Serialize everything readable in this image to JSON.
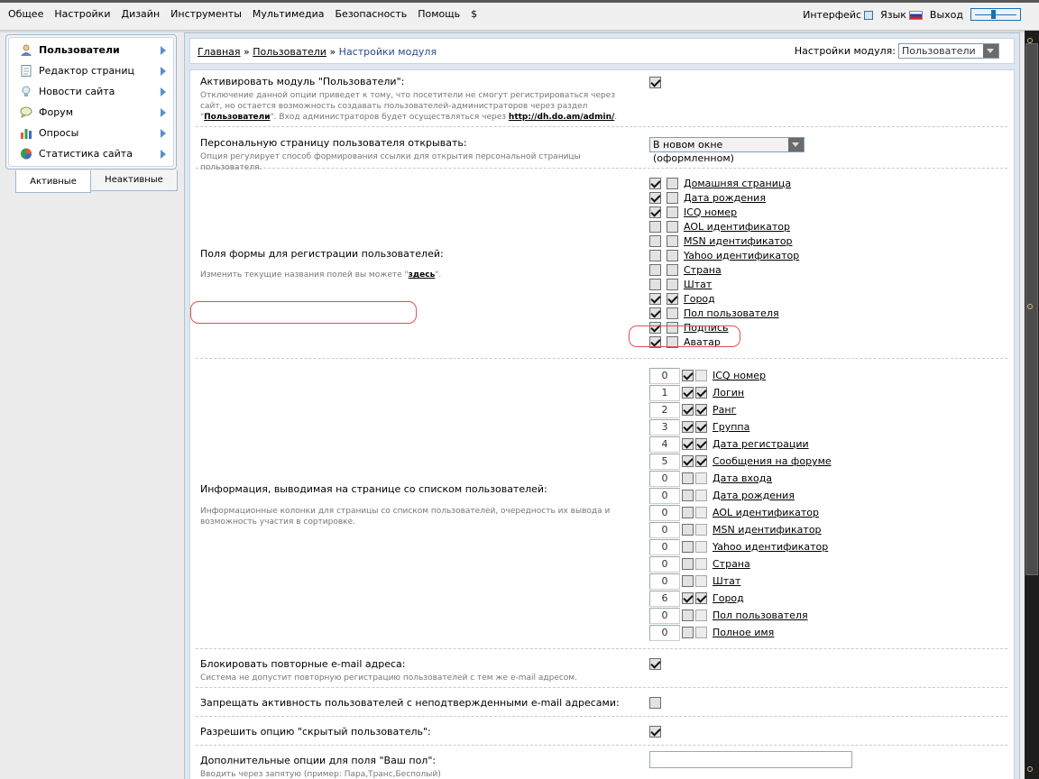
{
  "top_menu": {
    "items": [
      "Общее",
      "Настройки",
      "Дизайн",
      "Инструменты",
      "Мультимедиа",
      "Безопасность",
      "Помощь",
      "$"
    ],
    "interface_label": "Интерфейс",
    "language_label": "Язык",
    "logout_label": "Выход"
  },
  "sidebar": {
    "items": [
      {
        "label": "Пользователи",
        "icon": "user-icon",
        "active": true
      },
      {
        "label": "Редактор страниц",
        "icon": "page-icon",
        "active": false
      },
      {
        "label": "Новости сайта",
        "icon": "bulb-icon",
        "active": false
      },
      {
        "label": "Форум",
        "icon": "speech-bubble-icon",
        "active": false
      },
      {
        "label": "Опросы",
        "icon": "bar-chart-icon",
        "active": false
      },
      {
        "label": "Статистика сайта",
        "icon": "pie-chart-icon",
        "active": false
      }
    ],
    "tabs": {
      "active": "Активные",
      "inactive": "Неактивные"
    }
  },
  "breadcrumb": {
    "home": "Главная",
    "section": "Пользователи",
    "current": "Настройки модуля",
    "sep": "»"
  },
  "module_select": {
    "label": "Настройки модуля:",
    "value": "Пользователи"
  },
  "settings": {
    "activate": {
      "label": "Активировать модуль \"Пользователи\":",
      "desc_1": "Отключение данной опции приведет к тому, что посетители не смогут регистрироваться через сайт, но",
      "desc_2": "остается возможность создавать пользователей-администраторов через раздел \"",
      "desc_link": "Пользователи",
      "desc_3": "\". Вход",
      "desc_4": "администраторов будет осуществляться через ",
      "desc_url": "http://dh.do.am/admin/",
      "desc_5": ".",
      "checked": true
    },
    "personal_page": {
      "label": "Персональную страницу пользователя открывать:",
      "desc": "Опция регулирует способ формирования ссылки для открытия персональной страницы пользователя.",
      "value": "В новом окне (оформленном)"
    },
    "reg_fields": {
      "label": "Поля формы для регистрации пользователей:",
      "hint": "Изменить текущие названия полей вы можете \"",
      "hint_link": "здесь",
      "hint_end": "\".",
      "items": [
        {
          "label": "Домашняя страница",
          "enabled": true,
          "required": false
        },
        {
          "label": "Дата рождения",
          "enabled": true,
          "required": false
        },
        {
          "label": "ICQ номер",
          "enabled": true,
          "required": false
        },
        {
          "label": "AOL идентификатор",
          "enabled": false,
          "required": false
        },
        {
          "label": "MSN идентификатор",
          "enabled": false,
          "required": false
        },
        {
          "label": "Yahoo идентификатор",
          "enabled": false,
          "required": false
        },
        {
          "label": "Страна",
          "enabled": false,
          "required": false
        },
        {
          "label": "Штат",
          "enabled": false,
          "required": false
        },
        {
          "label": "Город",
          "enabled": true,
          "required": true
        },
        {
          "label": "Пол пользователя",
          "enabled": true,
          "required": false
        },
        {
          "label": "Подпись",
          "enabled": true,
          "required": false
        },
        {
          "label": "Аватар",
          "enabled": true,
          "required": false
        }
      ]
    },
    "list_info": {
      "label": "Информация, выводимая на странице со списком пользователей:",
      "desc": "Информационные колонки для страницы со списком пользователей, очередность их вывода и возможность участия в сортировке.",
      "items": [
        {
          "order": "0",
          "label": "ICQ номер",
          "show": true,
          "sort": false
        },
        {
          "order": "1",
          "label": "Логин",
          "show": true,
          "sort": true
        },
        {
          "order": "2",
          "label": "Ранг",
          "show": true,
          "sort": true
        },
        {
          "order": "3",
          "label": "Группа",
          "show": true,
          "sort": true
        },
        {
          "order": "4",
          "label": "Дата регистрации",
          "show": true,
          "sort": true
        },
        {
          "order": "5",
          "label": "Сообщения на форуме",
          "show": true,
          "sort": true
        },
        {
          "order": "0",
          "label": "Дата входа",
          "show": false,
          "sort": false
        },
        {
          "order": "0",
          "label": "Дата рождения",
          "show": false,
          "sort": false
        },
        {
          "order": "0",
          "label": "AOL идентификатор",
          "show": false,
          "sort": false
        },
        {
          "order": "0",
          "label": "MSN идентификатор",
          "show": false,
          "sort": false
        },
        {
          "order": "0",
          "label": "Yahoo идентификатор",
          "show": false,
          "sort": false
        },
        {
          "order": "0",
          "label": "Страна",
          "show": false,
          "sort": false
        },
        {
          "order": "0",
          "label": "Штат",
          "show": false,
          "sort": false
        },
        {
          "order": "6",
          "label": "Город",
          "show": true,
          "sort": true
        },
        {
          "order": "0",
          "label": "Пол пользователя",
          "show": false,
          "sort": false
        },
        {
          "order": "0",
          "label": "Полное имя",
          "show": false,
          "sort": false
        }
      ]
    },
    "block_email": {
      "label": "Блокировать повторные e-mail адреса:",
      "desc": "Система не допустит повторную регистрацию пользователей с тем же e-mail адресом.",
      "checked": true
    },
    "forbid_unconfirmed": {
      "label": "Запрещать активность пользователей с неподтвержденными e-mail адресами:",
      "checked": false
    },
    "hidden_user": {
      "label": "Разрешить опцию \"скрытый пользователь\":",
      "checked": true
    },
    "gender_options": {
      "label": "Дополнительные опции для поля \"Ваш пол\":",
      "desc": "Вводить через запятую (пример: Пара,Транс,Бесполый)",
      "value": ""
    }
  }
}
